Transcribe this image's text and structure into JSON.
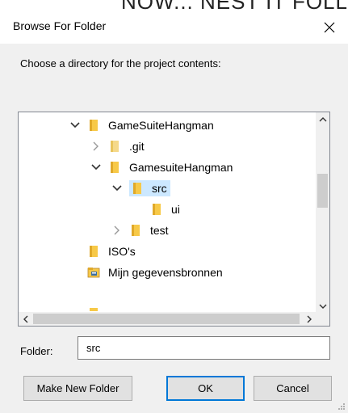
{
  "background_fragment": "NOW... NEST IT FOLLIESE",
  "dialog": {
    "title": "Browse For Folder",
    "prompt": "Choose a directory for the project contents:"
  },
  "tree": {
    "items": [
      {
        "label": "GameSuiteHangman",
        "expanded": true,
        "level": 1,
        "icon": "folder-icon"
      },
      {
        "label": ".git",
        "expanded": false,
        "level": 2,
        "icon": "folder-icon"
      },
      {
        "label": "GamesuiteHangman",
        "expanded": true,
        "level": 2,
        "icon": "folder-icon"
      },
      {
        "label": "src",
        "expanded": true,
        "level": 3,
        "selected": true,
        "icon": "folder-icon"
      },
      {
        "label": "ui",
        "level": 4,
        "icon": "folder-icon"
      },
      {
        "label": "test",
        "expanded": false,
        "level": 3,
        "icon": "folder-icon"
      },
      {
        "label": "ISO's",
        "level": 1,
        "icon": "folder-icon"
      },
      {
        "label": "Mijn gegevensbronnen",
        "level": 1,
        "icon": "special-folder-icon"
      }
    ]
  },
  "folder_field": {
    "label": "Folder:",
    "value": "src"
  },
  "buttons": {
    "make_new_folder": "Make New Folder",
    "ok": "OK",
    "cancel": "Cancel"
  },
  "colors": {
    "selection": "#cce8ff",
    "folder": "#f7c948",
    "default_button_border": "#0078d7"
  }
}
